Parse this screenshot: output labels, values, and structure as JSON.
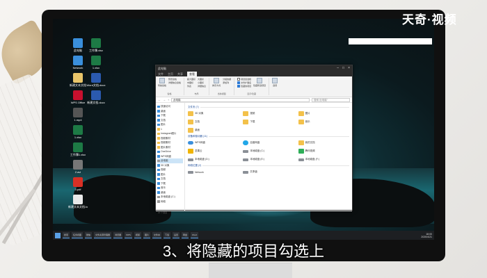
{
  "brand": "天奇·视频",
  "caption": "3、将隐藏的项目勾选上",
  "desktop_icons": [
    {
      "label": "此电脑",
      "color": "#3a8fdc"
    },
    {
      "label": "Network",
      "color": "#3a8fdc"
    },
    {
      "label": "新建文本文档",
      "color": "#e9c56a"
    },
    {
      "label": "WPS Office",
      "color": "#c8102e"
    },
    {
      "label": "1.mp4",
      "color": "#555"
    },
    {
      "label": "1.xlsx",
      "color": "#1d7a45"
    },
    {
      "label": "工作簿1.xlsx",
      "color": "#1d7a45"
    },
    {
      "label": "2.avi",
      "color": "#777"
    },
    {
      "label": "3.pdf",
      "color": "#d93025"
    },
    {
      "label": "新建文本文档.txt",
      "color": "#e9e9e9"
    },
    {
      "label": "工作簿.xlsx",
      "color": "#1d7a45"
    },
    {
      "label": "1.xlsx",
      "color": "#1d7a45"
    },
    {
      "label": "Word文档.docx",
      "color": "#2b5aaf"
    },
    {
      "label": "新建文档.docx",
      "color": "#2b5aaf"
    }
  ],
  "explorer": {
    "title": "此电脑",
    "controls": [
      "–",
      "□",
      "×"
    ],
    "tabs": [
      "文件",
      "主页",
      "共享",
      "查看"
    ],
    "active_tab": "查看",
    "ribbon": {
      "panes": {
        "buttons": [
          "导航窗格",
          "预览窗格",
          "详细信息窗格"
        ],
        "label": "窗格"
      },
      "layout": {
        "buttons": [
          "超大图标",
          "大图标",
          "中图标",
          "小图标",
          "列表",
          "详细信息"
        ],
        "label": "布局"
      },
      "current_view": {
        "buttons": [
          "排序方式",
          "分组依据",
          "添加列"
        ],
        "label": "当前视图"
      },
      "show_hide": {
        "items": [
          {
            "label": "项目复选框",
            "checked": false
          },
          {
            "label": "文件扩展名",
            "checked": true
          },
          {
            "label": "隐藏的项目",
            "checked": true
          }
        ],
        "hide_selected": "隐藏所选项目",
        "label": "显示/隐藏"
      },
      "options": "选项"
    },
    "path": "此电脑",
    "search_placeholder": "搜索\"此电脑\"",
    "nav": [
      {
        "label": "快速访问",
        "type": "blue"
      },
      {
        "label": "桌面",
        "type": "blue"
      },
      {
        "label": "下载",
        "type": "blue"
      },
      {
        "label": "文档",
        "type": "blue"
      },
      {
        "label": "图片",
        "type": "blue"
      },
      {
        "label": "1",
        "type": "folder"
      },
      {
        "label": "Instagram图片",
        "type": "folder"
      },
      {
        "label": "视频素材",
        "type": "folder"
      },
      {
        "label": "视频素材",
        "type": "folder"
      },
      {
        "label": "图片素材",
        "type": "folder"
      },
      {
        "label": "OneDrive",
        "type": "blue"
      },
      {
        "label": "WPS网盘",
        "type": "blue"
      },
      {
        "label": "此电脑",
        "type": "gray",
        "selected": true
      },
      {
        "label": "3D 对象",
        "type": "blue"
      },
      {
        "label": "视频",
        "type": "blue"
      },
      {
        "label": "图片",
        "type": "blue"
      },
      {
        "label": "文档",
        "type": "blue"
      },
      {
        "label": "下载",
        "type": "blue"
      },
      {
        "label": "音乐",
        "type": "blue"
      },
      {
        "label": "桌面",
        "type": "blue"
      },
      {
        "label": "本地磁盘 (C:)",
        "type": "gray"
      },
      {
        "label": "网络",
        "type": "gray"
      }
    ],
    "sections": [
      {
        "title": "文件夹 (7)",
        "items": [
          {
            "label": "3D 对象",
            "icon": "folder"
          },
          {
            "label": "视频",
            "icon": "folder"
          },
          {
            "label": "图片",
            "icon": "folder"
          },
          {
            "label": "文档",
            "icon": "folder"
          },
          {
            "label": "下载",
            "icon": "folder"
          },
          {
            "label": "音乐",
            "icon": "folder"
          },
          {
            "label": "桌面",
            "icon": "folder"
          }
        ]
      },
      {
        "title": "设备和驱动器 (11)",
        "items": [
          {
            "label": "WPS网盘",
            "icon": "cloud"
          },
          {
            "label": "百度网盘",
            "icon": "lblue"
          },
          {
            "label": "我的文档",
            "icon": "folder"
          },
          {
            "label": "坚果云",
            "icon": "yellowsq"
          },
          {
            "label": "本地磁盘 (C:)",
            "icon": "drive"
          },
          {
            "label": "腾讯视频",
            "icon": "green"
          },
          {
            "label": "本地磁盘 (D:)",
            "icon": "drive"
          },
          {
            "label": "本地磁盘 (E:)",
            "icon": "drive"
          },
          {
            "label": "本地磁盘 (F:)",
            "icon": "drive"
          }
        ]
      },
      {
        "title": "网络位置 (2)",
        "items": [
          {
            "label": "Network",
            "icon": "drive"
          },
          {
            "label": "共享盘",
            "icon": "drive"
          }
        ]
      }
    ],
    "status": "20 个项目"
  },
  "taskbar": {
    "items": [
      "",
      "搜索",
      "任务视图",
      "微信",
      "文件资源管理器",
      "浏览器",
      "WPS",
      "视频",
      "图片",
      "文件夹",
      "下载",
      "设置",
      "网盘",
      "Word"
    ],
    "time": "18:00",
    "date": "2020/4/21"
  }
}
